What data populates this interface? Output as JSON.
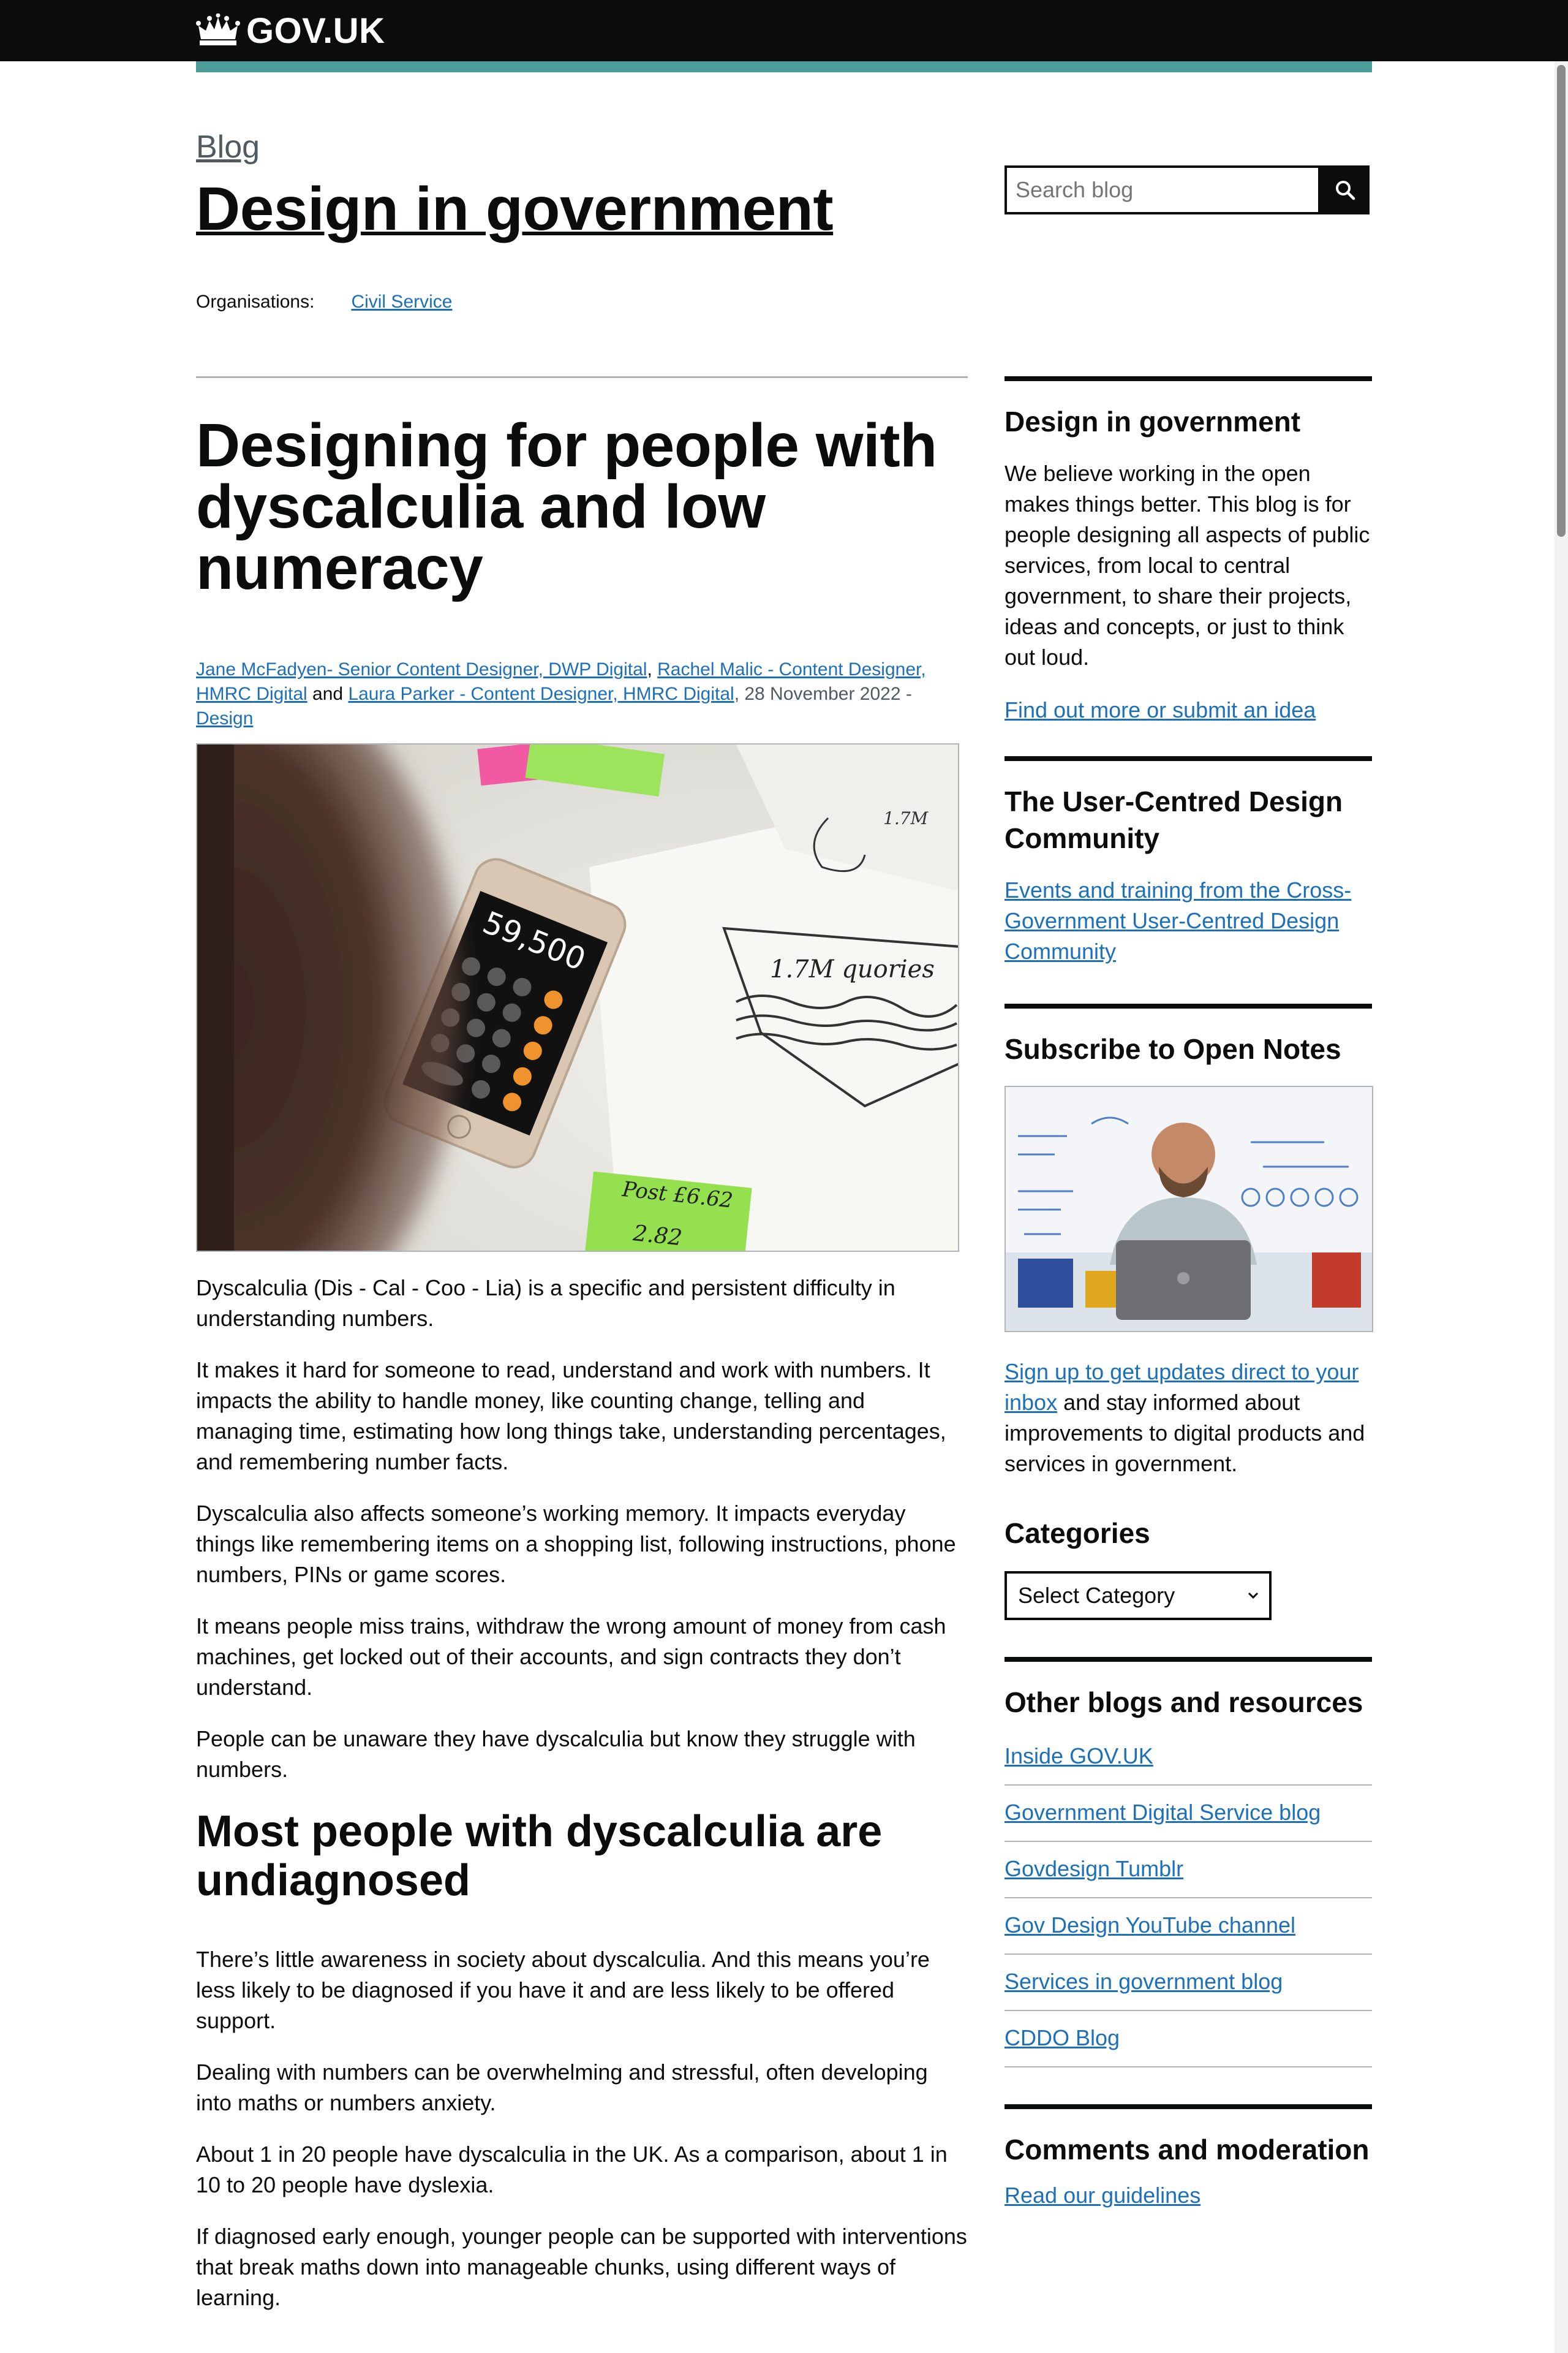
{
  "header": {
    "logo_text": "GOV.UK",
    "accent_color": "#4c9c9a"
  },
  "masthead": {
    "blog_label": "Blog",
    "title": "Design in government",
    "orgs_label": "Organisations:",
    "org_link": "Civil Service",
    "search_placeholder": "Search blog"
  },
  "article": {
    "title": "Designing for people with dyscalculia and low numeracy",
    "authors": [
      "Jane McFadyen- Senior Content Designer, DWP Digital",
      "Rachel Malic - Content Designer, HMRC Digital",
      "Laura Parker - Content Designer, HMRC Digital"
    ],
    "sep_comma": ",",
    "sep_and": "and",
    "date_text": ", 28 November 2022 -",
    "category": "Design",
    "image_texts": {
      "calculator_display": "59,500",
      "note_top": "1.7M quories",
      "note_small": "1.7M",
      "note_post": "Post £6.62",
      "note_bottom": "2.82"
    },
    "paragraphs": [
      "Dyscalculia (Dis - Cal - Coo - Lia) is a specific and persistent difficulty in understanding numbers.",
      "It makes it hard for someone to read, understand and work with numbers. It impacts the ability to handle money, like counting change, telling and managing time, estimating how long things take, understanding percentages, and remembering number facts.",
      "Dyscalculia also affects someone’s working memory. It impacts everyday things like remembering items on a shopping list, following instructions, phone numbers, PINs or game scores.",
      "It means people miss trains, withdraw the wrong amount of money from cash machines, get locked out of their accounts, and sign contracts they don’t understand.",
      "People can be unaware they have dyscalculia but know they struggle with numbers."
    ],
    "heading2": "Most people with dyscalculia are undiagnosed",
    "paragraphs2": [
      "There’s little awareness in society about dyscalculia. And this means you’re less likely to be diagnosed if you have it and are less likely to be offered support.",
      "Dealing with numbers can be overwhelming and stressful, often developing into maths or numbers anxiety.",
      "About 1 in 20 people have dyscalculia in the UK. As a comparison, about 1 in 10 to 20 people have dyslexia.",
      "If diagnosed early enough, younger people can be supported with interventions that break maths down into manageable chunks, using different ways of learning."
    ]
  },
  "sidebar": {
    "about": {
      "heading": "Design in government",
      "text": "We believe working in the open makes things better. This blog is for people designing all aspects of public services, from local to central government, to share their projects, ideas and concepts, or just to think out loud.",
      "link": "Find out more or submit an idea"
    },
    "community": {
      "heading": "The User-Centred Design Community",
      "link": "Events and training from the Cross-Government User-Centred Design Community"
    },
    "subscribe": {
      "heading": "Subscribe to Open Notes",
      "link": "Sign up to get updates direct to your inbox",
      "text": " and stay informed about improvements to digital products and services in government."
    },
    "categories": {
      "heading": "Categories",
      "selected": "Select Category"
    },
    "resources": {
      "heading": "Other blogs and resources",
      "links": [
        "Inside GOV.UK",
        "Government Digital Service blog",
        "Govdesign Tumblr",
        "Gov Design YouTube channel",
        "Services in government blog",
        "CDDO Blog"
      ]
    },
    "comments": {
      "heading": "Comments and moderation",
      "link": "Read our guidelines"
    }
  }
}
